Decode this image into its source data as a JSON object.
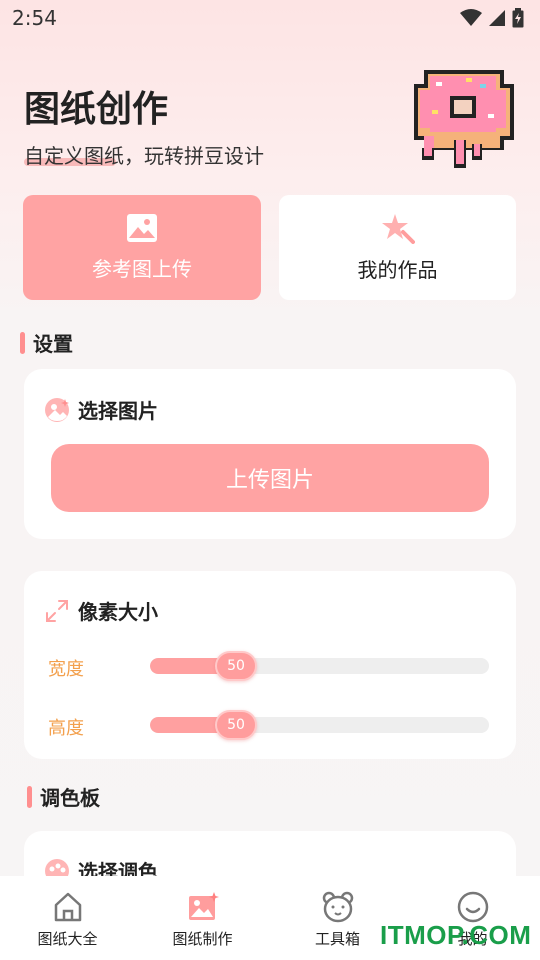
{
  "status": {
    "time": "2:54"
  },
  "header": {
    "title": "图纸创作",
    "subtitle": "自定义图纸，玩转拼豆设计"
  },
  "actions": {
    "upload_label": "参考图上传",
    "works_label": "我的作品"
  },
  "settings": {
    "section_title": "设置",
    "select_image_title": "选择图片",
    "upload_button_label": "上传图片",
    "pixel_size_title": "像素大小",
    "width_label": "宽度",
    "width_value": "50",
    "height_label": "高度",
    "height_value": "50"
  },
  "palette": {
    "section_title": "调色板",
    "select_palette_title": "选择调色"
  },
  "nav": {
    "items": [
      {
        "label": "图纸大全"
      },
      {
        "label": "图纸制作"
      },
      {
        "label": "工具箱"
      },
      {
        "label": "我的"
      }
    ]
  },
  "watermark": "ITMOP.COM",
  "colors": {
    "accent": "#ffa3a3",
    "label_orange": "#f3a04d",
    "watermark_green": "#1a9e4a"
  }
}
